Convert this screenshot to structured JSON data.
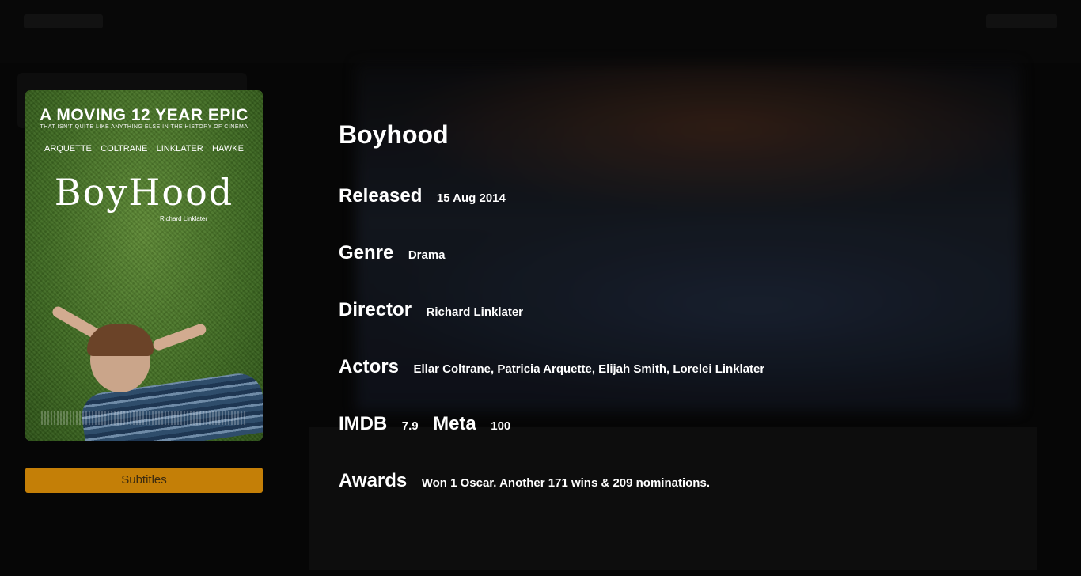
{
  "movie": {
    "title": "Boyhood",
    "released": {
      "label": "Released",
      "value": "15 Aug 2014"
    },
    "genre": {
      "label": "Genre",
      "value": "Drama"
    },
    "director": {
      "label": "Director",
      "value": "Richard Linklater"
    },
    "actors": {
      "label": "Actors",
      "value": "Ellar Coltrane, Patricia Arquette, Elijah Smith, Lorelei Linklater"
    },
    "imdb": {
      "label": "IMDB",
      "value": "7.9"
    },
    "meta": {
      "label": "Meta",
      "value": "100"
    },
    "awards": {
      "label": "Awards",
      "value": "Won 1 Oscar. Another 171 wins & 209 nominations."
    }
  },
  "poster": {
    "tagline": "A MOVING 12 YEAR EPIC",
    "subtagline": "THAT ISN'T QUITE LIKE ANYTHING ELSE IN THE HISTORY OF CINEMA",
    "cast": [
      "ARQUETTE",
      "COLTRANE",
      "LINKLATER",
      "HAWKE"
    ],
    "title_text": "BoyHood",
    "credit": "Richard Linklater"
  },
  "buttons": {
    "subtitles": "Subtitles"
  },
  "colors": {
    "accent": "#c47f07",
    "background": "#060606"
  }
}
